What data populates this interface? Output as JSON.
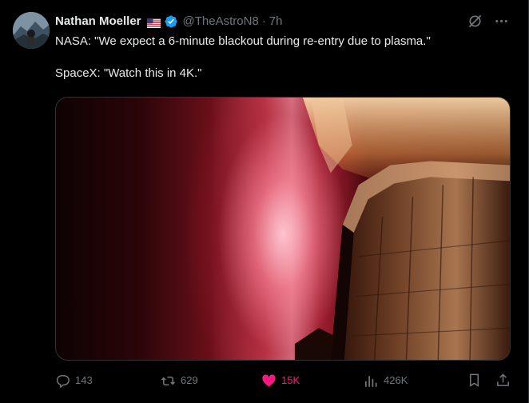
{
  "author": {
    "display_name": "Nathan Moeller",
    "handle": "@TheAstroN8",
    "separator": "·",
    "time": "7h",
    "flag_icon": "us-flag-icon",
    "verified_icon": "verified-badge-icon",
    "verified_color": "#1d9bf0"
  },
  "post": {
    "line1": "NASA: \"We expect a 6-minute blackout during re-entry due to plasma.\"",
    "line2": "SpaceX: \"Watch this in 4K.\""
  },
  "actions": {
    "reply_count": "143",
    "retweet_count": "629",
    "like_count": "15K",
    "views_count": "426K",
    "like_color": "#f91880",
    "muted_color": "#71767b"
  },
  "icons": {
    "grok": "grok-icon",
    "more": "more-icon",
    "reply": "reply-icon",
    "retweet": "retweet-icon",
    "like": "heart-icon",
    "views": "views-icon",
    "bookmark": "bookmark-icon",
    "share": "share-icon"
  }
}
